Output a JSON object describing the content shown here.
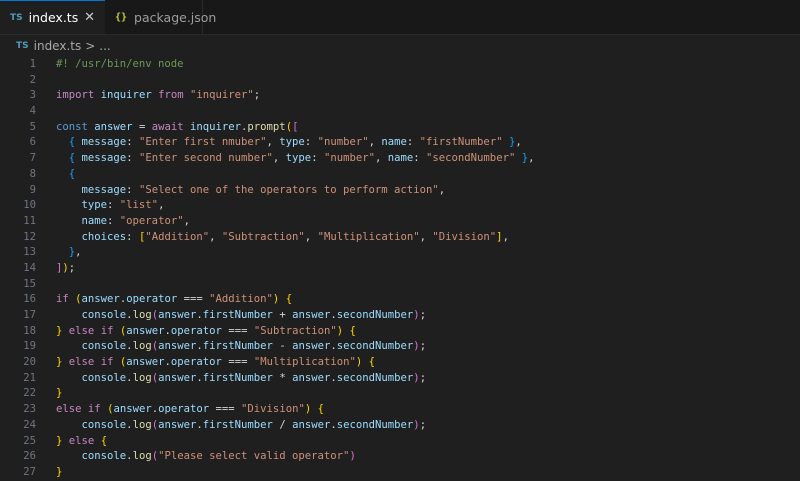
{
  "tabs": [
    {
      "badge": "TS",
      "label": "index.ts",
      "close": "✕"
    },
    {
      "badge": "{}",
      "label": "package.json"
    }
  ],
  "breadcrumb": {
    "badge": "TS",
    "file": "index.ts",
    "sep": ">",
    "rest": "..."
  },
  "code": {
    "line_numbers": [
      "1",
      "2",
      "3",
      "4",
      "5",
      "6",
      "7",
      "8",
      "9",
      "10",
      "11",
      "12",
      "13",
      "14",
      "15",
      "16",
      "17",
      "18",
      "19",
      "20",
      "21",
      "22",
      "23",
      "24",
      "25",
      "26",
      "27"
    ],
    "lines": [
      [
        [
          "cm",
          "#! /usr/bin/env node"
        ]
      ],
      [],
      [
        [
          "kw",
          "import"
        ],
        [
          "pl",
          " "
        ],
        [
          "var",
          "inquirer"
        ],
        [
          "pl",
          " "
        ],
        [
          "kw",
          "from"
        ],
        [
          "pl",
          " "
        ],
        [
          "str",
          "\"inquirer\""
        ],
        [
          "pl",
          ";"
        ]
      ],
      [],
      [
        [
          "dc",
          "const"
        ],
        [
          "pl",
          " "
        ],
        [
          "var",
          "answer"
        ],
        [
          "pl",
          " = "
        ],
        [
          "kw",
          "await"
        ],
        [
          "pl",
          " "
        ],
        [
          "var",
          "inquirer"
        ],
        [
          "pl",
          "."
        ],
        [
          "fn",
          "prompt"
        ],
        [
          "b1",
          "("
        ],
        [
          "b2",
          "["
        ]
      ],
      [
        [
          "pl",
          "  "
        ],
        [
          "b3",
          "{"
        ],
        [
          "pl",
          " "
        ],
        [
          "var",
          "message"
        ],
        [
          "pl",
          ": "
        ],
        [
          "str",
          "\"Enter first nmuber\""
        ],
        [
          "pl",
          ", "
        ],
        [
          "var",
          "type"
        ],
        [
          "pl",
          ": "
        ],
        [
          "str",
          "\"number\""
        ],
        [
          "pl",
          ", "
        ],
        [
          "var",
          "name"
        ],
        [
          "pl",
          ": "
        ],
        [
          "str",
          "\"firstNumber\""
        ],
        [
          "pl",
          " "
        ],
        [
          "b3",
          "}"
        ],
        [
          "pl",
          ","
        ]
      ],
      [
        [
          "pl",
          "  "
        ],
        [
          "b3",
          "{"
        ],
        [
          "pl",
          " "
        ],
        [
          "var",
          "message"
        ],
        [
          "pl",
          ": "
        ],
        [
          "str",
          "\"Enter second number\""
        ],
        [
          "pl",
          ", "
        ],
        [
          "var",
          "type"
        ],
        [
          "pl",
          ": "
        ],
        [
          "str",
          "\"number\""
        ],
        [
          "pl",
          ", "
        ],
        [
          "var",
          "name"
        ],
        [
          "pl",
          ": "
        ],
        [
          "str",
          "\"secondNumber\""
        ],
        [
          "pl",
          " "
        ],
        [
          "b3",
          "}"
        ],
        [
          "pl",
          ","
        ]
      ],
      [
        [
          "pl",
          "  "
        ],
        [
          "b3",
          "{"
        ]
      ],
      [
        [
          "pl",
          "    "
        ],
        [
          "var",
          "message"
        ],
        [
          "pl",
          ": "
        ],
        [
          "str",
          "\"Select one of the operators to perform action\""
        ],
        [
          "pl",
          ","
        ]
      ],
      [
        [
          "pl",
          "    "
        ],
        [
          "var",
          "type"
        ],
        [
          "pl",
          ": "
        ],
        [
          "str",
          "\"list\""
        ],
        [
          "pl",
          ","
        ]
      ],
      [
        [
          "pl",
          "    "
        ],
        [
          "var",
          "name"
        ],
        [
          "pl",
          ": "
        ],
        [
          "str",
          "\"operator\""
        ],
        [
          "pl",
          ","
        ]
      ],
      [
        [
          "pl",
          "    "
        ],
        [
          "var",
          "choices"
        ],
        [
          "pl",
          ": "
        ],
        [
          "b1",
          "["
        ],
        [
          "str",
          "\"Addition\""
        ],
        [
          "pl",
          ", "
        ],
        [
          "str",
          "\"Subtraction\""
        ],
        [
          "pl",
          ", "
        ],
        [
          "str",
          "\"Multiplication\""
        ],
        [
          "pl",
          ", "
        ],
        [
          "str",
          "\"Division\""
        ],
        [
          "b1",
          "]"
        ],
        [
          "pl",
          ","
        ]
      ],
      [
        [
          "pl",
          "  "
        ],
        [
          "b3",
          "}"
        ],
        [
          "pl",
          ","
        ]
      ],
      [
        [
          "b2",
          "]"
        ],
        [
          "b1",
          ")"
        ],
        [
          "pl",
          ";"
        ]
      ],
      [],
      [
        [
          "kw",
          "if"
        ],
        [
          "pl",
          " "
        ],
        [
          "b1",
          "("
        ],
        [
          "var",
          "answer"
        ],
        [
          "pl",
          "."
        ],
        [
          "var",
          "operator"
        ],
        [
          "pl",
          " === "
        ],
        [
          "str",
          "\"Addition\""
        ],
        [
          "b1",
          ")"
        ],
        [
          "pl",
          " "
        ],
        [
          "b1",
          "{"
        ]
      ],
      [
        [
          "pl",
          "    "
        ],
        [
          "var",
          "console"
        ],
        [
          "pl",
          "."
        ],
        [
          "fn",
          "log"
        ],
        [
          "b2",
          "("
        ],
        [
          "var",
          "answer"
        ],
        [
          "pl",
          "."
        ],
        [
          "var",
          "firstNumber"
        ],
        [
          "pl",
          " + "
        ],
        [
          "var",
          "answer"
        ],
        [
          "pl",
          "."
        ],
        [
          "var",
          "secondNumber"
        ],
        [
          "b2",
          ")"
        ],
        [
          "pl",
          ";"
        ]
      ],
      [
        [
          "b1",
          "}"
        ],
        [
          "pl",
          " "
        ],
        [
          "kw",
          "else"
        ],
        [
          "pl",
          " "
        ],
        [
          "kw",
          "if"
        ],
        [
          "pl",
          " "
        ],
        [
          "b1",
          "("
        ],
        [
          "var",
          "answer"
        ],
        [
          "pl",
          "."
        ],
        [
          "var",
          "operator"
        ],
        [
          "pl",
          " === "
        ],
        [
          "str",
          "\"Subtraction\""
        ],
        [
          "b1",
          ")"
        ],
        [
          "pl",
          " "
        ],
        [
          "b1",
          "{"
        ]
      ],
      [
        [
          "pl",
          "    "
        ],
        [
          "var",
          "console"
        ],
        [
          "pl",
          "."
        ],
        [
          "fn",
          "log"
        ],
        [
          "b2",
          "("
        ],
        [
          "var",
          "answer"
        ],
        [
          "pl",
          "."
        ],
        [
          "var",
          "firstNumber"
        ],
        [
          "pl",
          " - "
        ],
        [
          "var",
          "answer"
        ],
        [
          "pl",
          "."
        ],
        [
          "var",
          "secondNumber"
        ],
        [
          "b2",
          ")"
        ],
        [
          "pl",
          ";"
        ]
      ],
      [
        [
          "b1",
          "}"
        ],
        [
          "pl",
          " "
        ],
        [
          "kw",
          "else"
        ],
        [
          "pl",
          " "
        ],
        [
          "kw",
          "if"
        ],
        [
          "pl",
          " "
        ],
        [
          "b1",
          "("
        ],
        [
          "var",
          "answer"
        ],
        [
          "pl",
          "."
        ],
        [
          "var",
          "operator"
        ],
        [
          "pl",
          " === "
        ],
        [
          "str",
          "\"Multiplication\""
        ],
        [
          "b1",
          ")"
        ],
        [
          "pl",
          " "
        ],
        [
          "b1",
          "{"
        ]
      ],
      [
        [
          "pl",
          "    "
        ],
        [
          "var",
          "console"
        ],
        [
          "pl",
          "."
        ],
        [
          "fn",
          "log"
        ],
        [
          "b2",
          "("
        ],
        [
          "var",
          "answer"
        ],
        [
          "pl",
          "."
        ],
        [
          "var",
          "firstNumber"
        ],
        [
          "pl",
          " * "
        ],
        [
          "var",
          "answer"
        ],
        [
          "pl",
          "."
        ],
        [
          "var",
          "secondNumber"
        ],
        [
          "b2",
          ")"
        ],
        [
          "pl",
          ";"
        ]
      ],
      [
        [
          "b1",
          "}"
        ]
      ],
      [
        [
          "kw",
          "else"
        ],
        [
          "pl",
          " "
        ],
        [
          "kw",
          "if"
        ],
        [
          "pl",
          " "
        ],
        [
          "b1",
          "("
        ],
        [
          "var",
          "answer"
        ],
        [
          "pl",
          "."
        ],
        [
          "var",
          "operator"
        ],
        [
          "pl",
          " === "
        ],
        [
          "str",
          "\"Division\""
        ],
        [
          "b1",
          ")"
        ],
        [
          "pl",
          " "
        ],
        [
          "b1",
          "{"
        ]
      ],
      [
        [
          "pl",
          "    "
        ],
        [
          "var",
          "console"
        ],
        [
          "pl",
          "."
        ],
        [
          "fn",
          "log"
        ],
        [
          "b2",
          "("
        ],
        [
          "var",
          "answer"
        ],
        [
          "pl",
          "."
        ],
        [
          "var",
          "firstNumber"
        ],
        [
          "pl",
          " / "
        ],
        [
          "var",
          "answer"
        ],
        [
          "pl",
          "."
        ],
        [
          "var",
          "secondNumber"
        ],
        [
          "b2",
          ")"
        ],
        [
          "pl",
          ";"
        ]
      ],
      [
        [
          "b1",
          "}"
        ],
        [
          "pl",
          " "
        ],
        [
          "kw",
          "else"
        ],
        [
          "pl",
          " "
        ],
        [
          "b1",
          "{"
        ]
      ],
      [
        [
          "pl",
          "    "
        ],
        [
          "var",
          "console"
        ],
        [
          "pl",
          "."
        ],
        [
          "fn",
          "log"
        ],
        [
          "b2",
          "("
        ],
        [
          "str",
          "\"Please select valid operator\""
        ],
        [
          "b2",
          ")"
        ]
      ],
      [
        [
          "b1",
          "}"
        ]
      ]
    ]
  }
}
